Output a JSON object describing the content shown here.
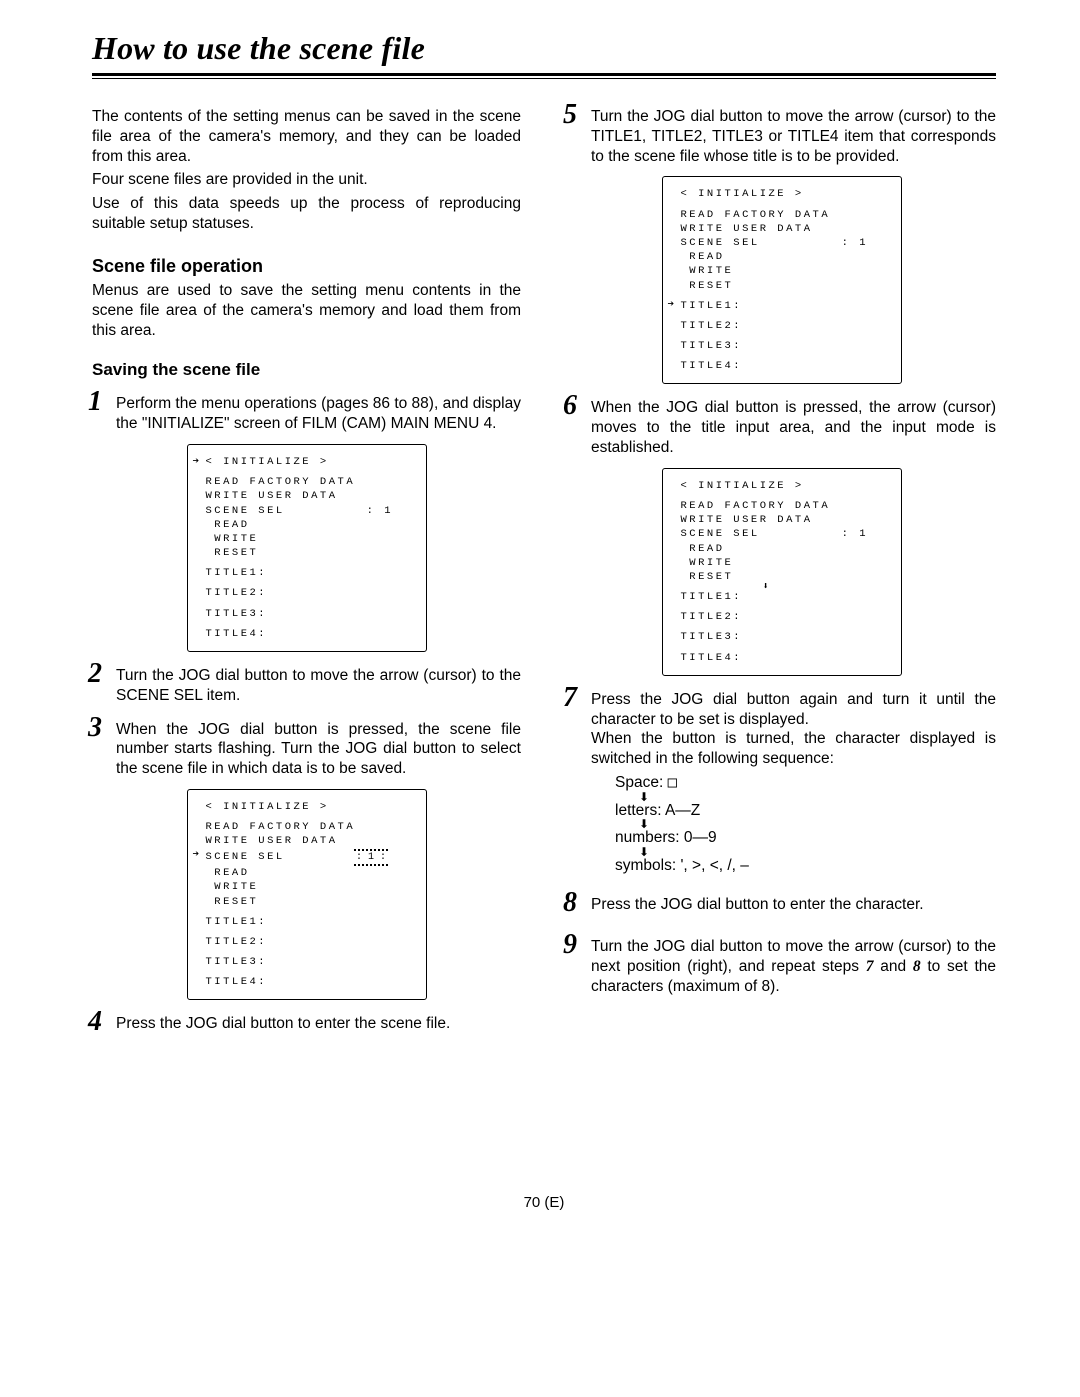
{
  "title": "How to use the scene file",
  "footer": "70 (E)",
  "left": {
    "intro1": "The contents of the setting menus can be saved in the scene file area of the camera's memory, and they can be loaded from this area.",
    "intro2": "Four scene files are provided in the unit.",
    "intro3": "Use of this data speeds up the process of reproducing suitable setup statuses.",
    "h_scene_op": "Scene file operation",
    "scene_op_p": "Menus are used to save the setting menu contents in the scene file area of the camera's memory and load them from this area.",
    "h_saving": "Saving the scene file",
    "step1": "Perform the menu operations (pages 86 to 88), and display the \"INITIALIZE\" screen of FILM (CAM) MAIN MENU 4.",
    "step2": "Turn the JOG dial button to move the arrow (cursor) to the SCENE SEL item.",
    "step3": "When the JOG dial button is pressed, the scene file number starts flashing.  Turn the JOG dial button to select the scene file in which data is to be saved.",
    "step4": "Press the JOG dial button to enter the scene file."
  },
  "right": {
    "step5": "Turn the JOG dial button to move the arrow (cursor) to the TITLE1, TITLE2, TITLE3 or TITLE4 item that corresponds to the scene file whose title is to be provided.",
    "step6": "When the JOG dial button is pressed, the arrow (cursor) moves to the title input area, and the input mode is established.",
    "step7a": "Press the JOG dial button again and turn it until the character to be set is displayed.",
    "step7b": "When the button is turned, the character displayed is switched in the following sequence:",
    "seq_space": "Space: ",
    "seq_letters": "letters: A—Z",
    "seq_numbers": "numbers: 0—9",
    "seq_symbols": "symbols: ', >, <, /, –",
    "step8": "Press the JOG dial button to enter the character.",
    "step9a": "Turn the JOG dial button to move the arrow (cursor) to the next position (right), and repeat steps ",
    "step9_7": "7",
    "step9_mid": " and ",
    "step9_8": "8",
    "step9b": " to set the characters (maximum of 8)."
  },
  "menu": {
    "header": "< INITIALIZE >",
    "l_read_factory": "READ FACTORY DATA",
    "l_write_user": "WRITE USER DATA",
    "l_scene_sel": "SCENE SEL",
    "l_scene_val": ": 1",
    "l_scene_val_blink": ": 1 :",
    "l_read": " READ",
    "l_write": " WRITE",
    "l_reset": " RESET",
    "l_t1": "TITLE1:",
    "l_t2": "TITLE2:",
    "l_t3": "TITLE3:",
    "l_t4": "TITLE4:"
  }
}
